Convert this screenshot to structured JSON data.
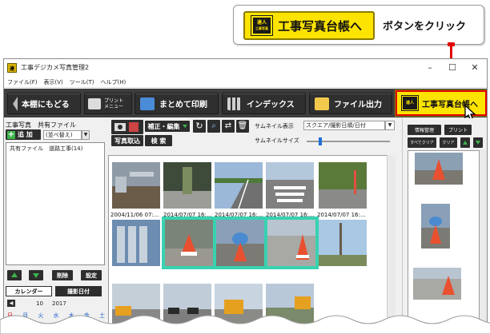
{
  "callout": {
    "button_label": "工事写真台帳へ",
    "stamp_text_top": "達人",
    "stamp_text_bottom": "工事写真",
    "instruction": "ボタンをクリック"
  },
  "window": {
    "title": "工事デジカメ写真管理2",
    "controls": [
      "–",
      "☐",
      "✕"
    ]
  },
  "menu": [
    "ファイル(F)",
    "表示(V)",
    "ツール(T)",
    "ヘルプ(H)"
  ],
  "toolbar": {
    "back_label": "本棚にもどる",
    "print_menu_line1": "プリント",
    "print_menu_line2": "メニュー",
    "batch_print_label": "まとめて印刷",
    "index_label": "インデックス",
    "file_output_label": "ファイル出力",
    "ledger_label": "工事写真台帳へ"
  },
  "left_panel": {
    "title": "工事写真　共有ファイル",
    "add_label": "追 加",
    "sort_value": "(並べ替え)",
    "tree_item": "共有ファイル　道路工事(14)",
    "delete_label": "削除",
    "settings_label": "設定",
    "calendar_label": "カレンダー",
    "shoot_date_label": "撮影日付",
    "month": "10",
    "year": "2017",
    "weekdays": [
      "日",
      "月",
      "火",
      "水",
      "木",
      "金",
      "土"
    ]
  },
  "mid_tools": {
    "import_label": "写真取込",
    "edit_label": "補正・編集",
    "search_label": "検 索",
    "thumb_display_label": "サムネイル表示",
    "thumb_display_value": "スクエア/撮影日順/日付",
    "thumb_size_label": "サムネイルサイズ",
    "thumb_size_level": 0.15
  },
  "grid": {
    "captions": [
      "2004/11/06 07:...",
      "2014/07/07 16:...",
      "2014/07/07 16:...",
      "2014/07/07 16:...",
      "2014/07/07 16:..."
    ]
  },
  "right_panel": {
    "info_label": "情報管理",
    "print_label": "プリント",
    "clear_all_label": "すべてクリア",
    "clear_label": "クリア"
  },
  "colors": {
    "accent_yellow": "#fde400",
    "highlight_red": "#e00000",
    "selection_teal": "#38d2b0",
    "toolbar_dark": "#3d3d3d",
    "arrow_green": "#3bb44a"
  }
}
